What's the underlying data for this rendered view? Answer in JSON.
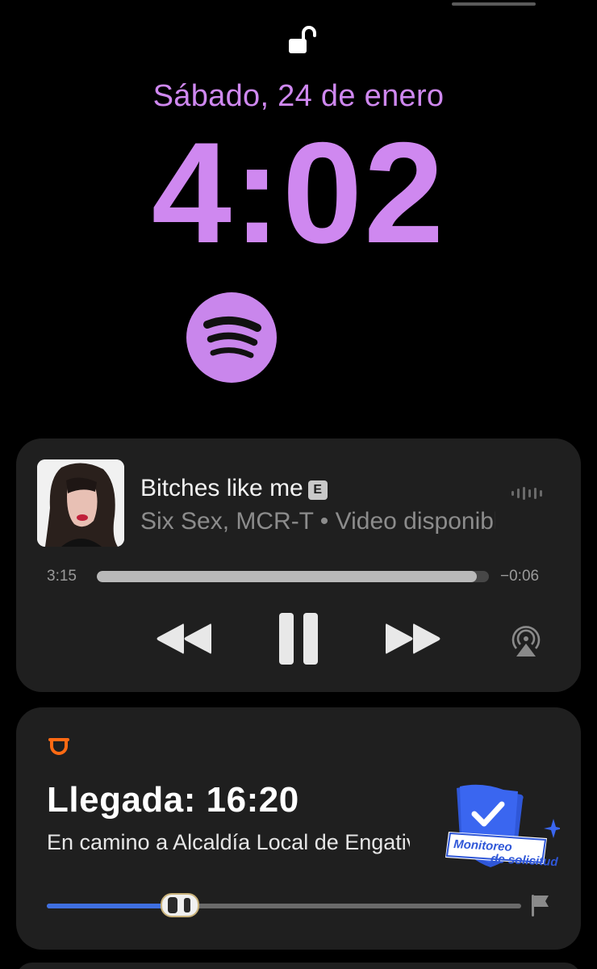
{
  "lockscreen": {
    "date": "Sábado, 24 de enero",
    "time": "4:02",
    "accent_color": "#cf88f0",
    "lock_state_icon": "unlocked-padlock-icon",
    "widget_icon": "spotify-icon"
  },
  "now_playing": {
    "title": "Bitches like me",
    "explicit_label": "E",
    "artist_line": "Six Sex, MCR-T • Video disponible",
    "elapsed": "3:15",
    "remaining": "−0:06",
    "progress": 0.97,
    "controls": [
      "rewind-icon",
      "pause-icon",
      "fast-forward-icon",
      "airplay-icon"
    ]
  },
  "ride": {
    "app_icon": "didi-logo-icon",
    "arrival": "Llegada: 16:20",
    "route": "En camino a Alcaldía Local de Engativá",
    "badge_line1": "Monitoreo",
    "badge_line2": "de solicitud",
    "trip_progress": 0.28,
    "progress_color": "#3f6fe0",
    "brand_color": "#ff6a13"
  }
}
